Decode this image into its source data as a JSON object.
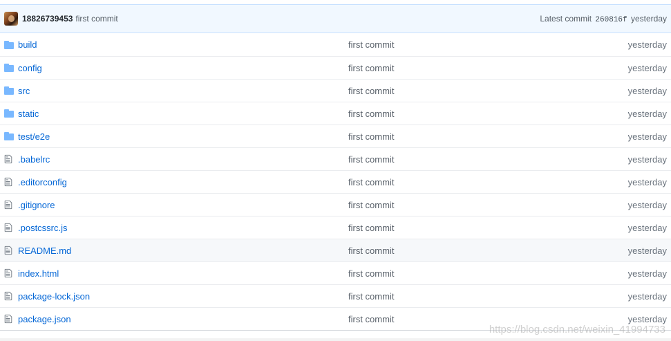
{
  "commit_tease": {
    "author": "18826739453",
    "message": "first commit",
    "latest_label": "Latest commit",
    "sha": "260816f",
    "age": "yesterday"
  },
  "icons": {
    "directory": "folder-icon",
    "file": "file-icon"
  },
  "colors": {
    "link": "#0366d6",
    "folder": "#79b8ff",
    "header_bg": "#f1f8ff",
    "row_hover_bg": "#f6f8fa"
  },
  "files": [
    {
      "type": "dir",
      "name": "build",
      "message": "first commit",
      "age": "yesterday"
    },
    {
      "type": "dir",
      "name": "config",
      "message": "first commit",
      "age": "yesterday"
    },
    {
      "type": "dir",
      "name": "src",
      "message": "first commit",
      "age": "yesterday"
    },
    {
      "type": "dir",
      "name": "static",
      "message": "first commit",
      "age": "yesterday"
    },
    {
      "type": "dir",
      "name": "test/e2e",
      "message": "first commit",
      "age": "yesterday"
    },
    {
      "type": "file",
      "name": ".babelrc",
      "message": "first commit",
      "age": "yesterday"
    },
    {
      "type": "file",
      "name": ".editorconfig",
      "message": "first commit",
      "age": "yesterday"
    },
    {
      "type": "file",
      "name": ".gitignore",
      "message": "first commit",
      "age": "yesterday"
    },
    {
      "type": "file",
      "name": ".postcssrc.js",
      "message": "first commit",
      "age": "yesterday"
    },
    {
      "type": "file",
      "name": "README.md",
      "message": "first commit",
      "age": "yesterday",
      "hover": true
    },
    {
      "type": "file",
      "name": "index.html",
      "message": "first commit",
      "age": "yesterday"
    },
    {
      "type": "file",
      "name": "package-lock.json",
      "message": "first commit",
      "age": "yesterday"
    },
    {
      "type": "file",
      "name": "package.json",
      "message": "first commit",
      "age": "yesterday"
    }
  ],
  "watermark": "https://blog.csdn.net/weixin_41994733"
}
